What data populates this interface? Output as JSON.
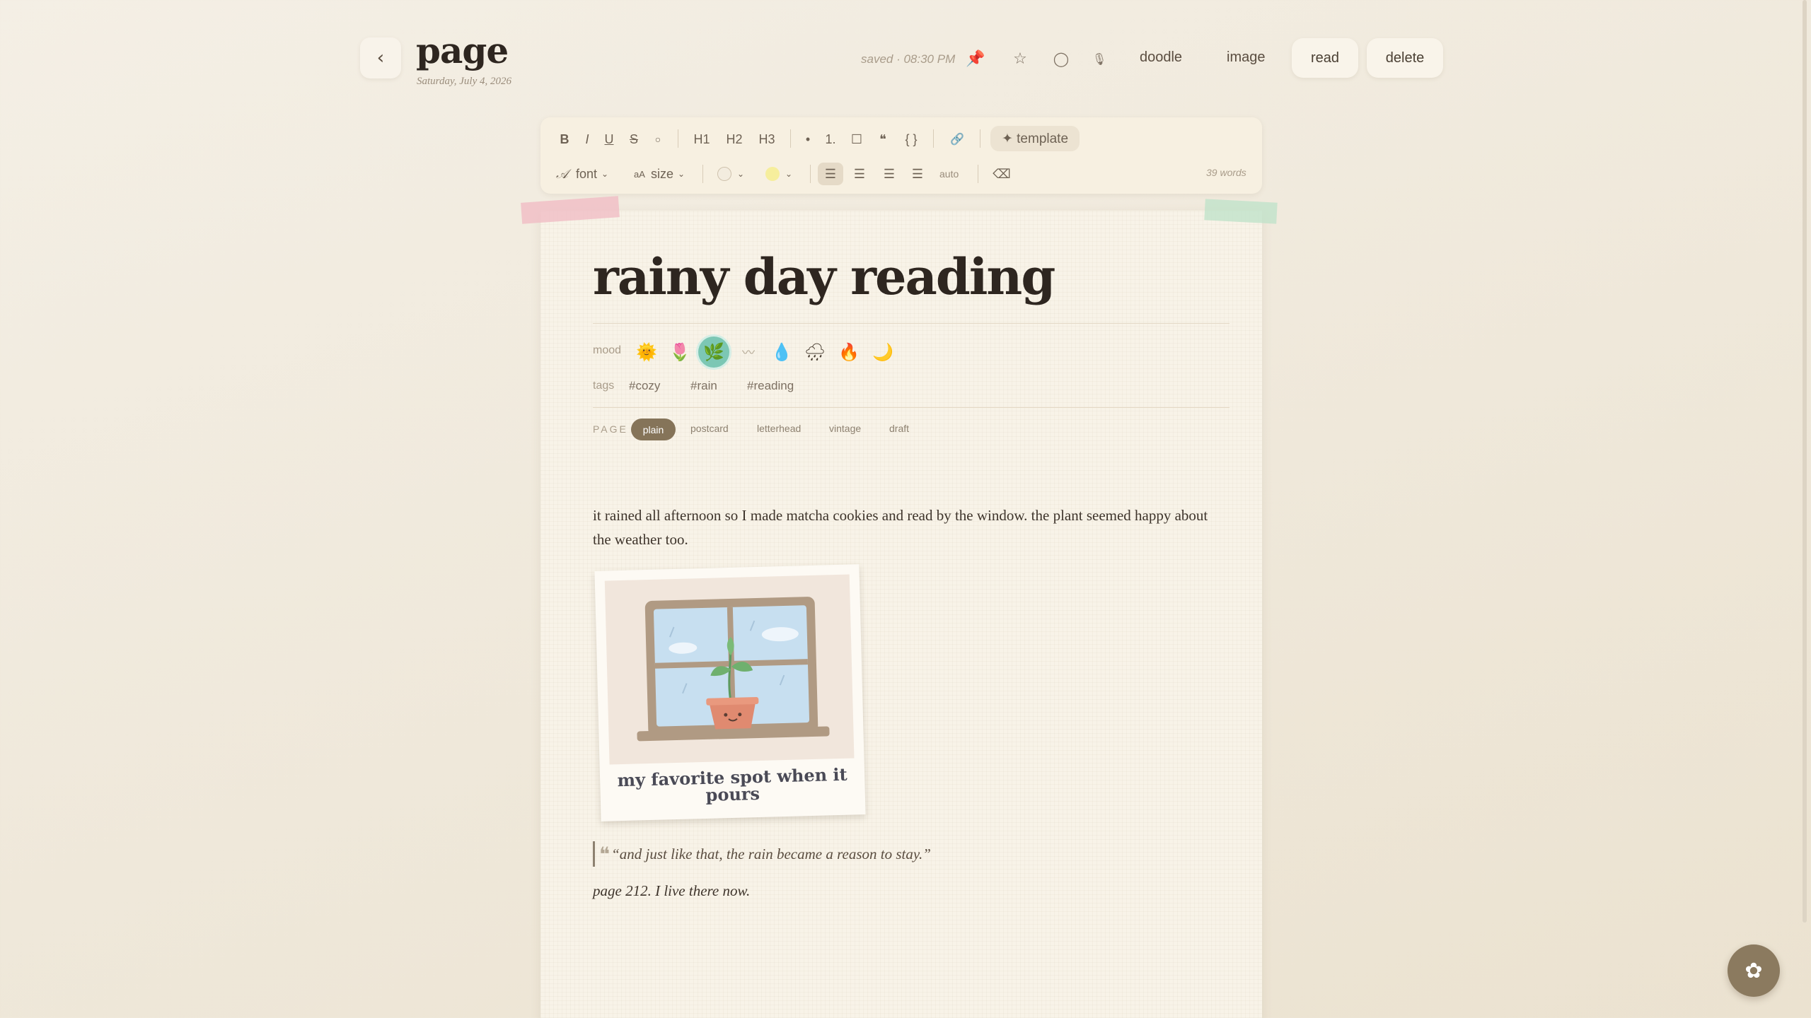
{
  "header": {
    "back_icon": "‹",
    "title": "page",
    "date": "Saturday, July 4, 2026",
    "saved_status": "saved · 08:30 PM",
    "pin_icon": "📌",
    "star_icon": "☆",
    "circle_icon": "◯",
    "mic_icon": "🎙",
    "doodle_label": "doodle",
    "image_label": "image",
    "read_label": "read",
    "delete_label": "delete"
  },
  "toolbar": {
    "bold": "B",
    "italic": "I",
    "underline": "U",
    "strike": "S",
    "circle": "○",
    "h1": "H1",
    "h2": "H2",
    "h3": "H3",
    "bullet": "•",
    "numbered": "1.",
    "checkbox": "☐",
    "quote": "❝",
    "code": "{ }",
    "link": "🔗",
    "template_label": "✦ template",
    "font_label": "font",
    "size_label": "size",
    "size_prefix": "aA",
    "auto_label": "auto",
    "clear_icon": "⌫",
    "word_count": "39 words"
  },
  "entry": {
    "title": "rainy day reading",
    "mood_label": "mood",
    "moods": [
      "🌞",
      "🌷",
      "🌿",
      "〰",
      "💧",
      "🌧",
      "🔥",
      "🌙"
    ],
    "active_mood_index": 2,
    "tags_label": "tags",
    "tags": [
      "#cozy",
      "#rain",
      "#reading"
    ],
    "page_label": "PAGE",
    "page_styles": [
      "plain",
      "postcard",
      "letterhead",
      "vintage",
      "draft"
    ],
    "active_page_style": "plain",
    "body": "it rained all afternoon so I made matcha cookies and read by the window. the plant seemed happy about the weather too.",
    "photo_caption": "my favorite spot when it pours",
    "quote": "“and just like that, the rain became a reason to stay.”",
    "quote_mark": "❝",
    "after_quote": "page 212. I live there now."
  },
  "fab_icon": "✿"
}
